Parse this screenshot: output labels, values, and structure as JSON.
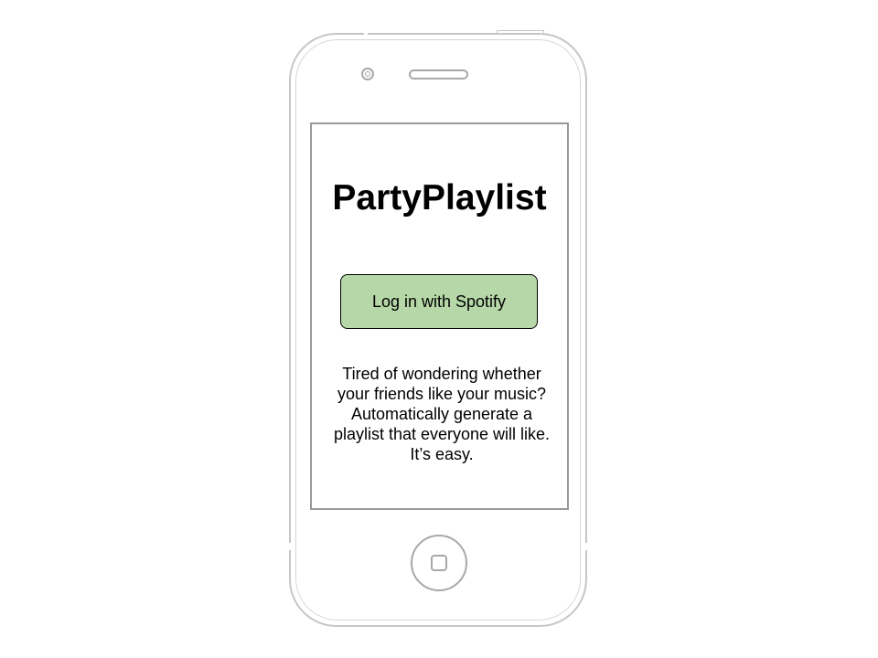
{
  "app": {
    "title": "PartyPlaylist"
  },
  "login": {
    "button_label": "Log in with Spotify",
    "button_color": "#b6d7a8"
  },
  "tagline": {
    "text": "Tired of wondering whether your friends like your music? Automatically generate a playlist that everyone will like. It’s easy."
  },
  "device": {
    "type": "smartphone wireframe",
    "icons": [
      "camera-icon",
      "speaker-icon",
      "home-button-icon"
    ]
  }
}
